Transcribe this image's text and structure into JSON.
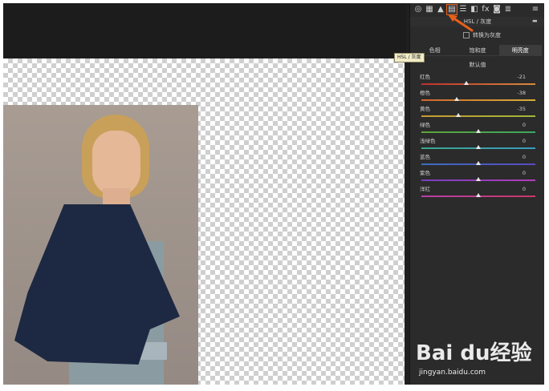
{
  "panel": {
    "section_title": "HSL / 灰度",
    "convert_gray_label": "转换为灰度",
    "tabs": [
      {
        "label": "色相",
        "active": false
      },
      {
        "label": "饱和度",
        "active": false
      },
      {
        "label": "明亮度",
        "active": true
      }
    ],
    "tooltip": "HSL / 灰度",
    "default_link": "默认值",
    "sliders": [
      {
        "label": "红色",
        "value": "-21",
        "position": -21,
        "gradient": [
          "#c0302e",
          "#d88a39"
        ]
      },
      {
        "label": "橙色",
        "value": "-38",
        "position": -38,
        "gradient": [
          "#d2662e",
          "#d8b039"
        ]
      },
      {
        "label": "黄色",
        "value": "-35",
        "position": -35,
        "gradient": [
          "#c99a32",
          "#9fb83a"
        ]
      },
      {
        "label": "绿色",
        "value": "0",
        "position": 0,
        "gradient": [
          "#5ea43a",
          "#3aa860"
        ]
      },
      {
        "label": "浅绿色",
        "value": "0",
        "position": 0,
        "gradient": [
          "#3aa68e",
          "#3a9cc0"
        ]
      },
      {
        "label": "蓝色",
        "value": "0",
        "position": 0,
        "gradient": [
          "#3a6ec0",
          "#5a4ac0"
        ]
      },
      {
        "label": "紫色",
        "value": "0",
        "position": 0,
        "gradient": [
          "#7a3ec0",
          "#b03eb8"
        ]
      },
      {
        "label": "洋红",
        "value": "0",
        "position": 0,
        "gradient": [
          "#b83ea8",
          "#c83868"
        ]
      }
    ],
    "accent_color": "#e8601a"
  },
  "toolbar_icons": [
    {
      "name": "aperture-icon",
      "glyph": "◎",
      "active": false
    },
    {
      "name": "histogram-icon",
      "glyph": "▦",
      "active": false
    },
    {
      "name": "tone-curve-icon",
      "glyph": "▲",
      "active": false
    },
    {
      "name": "hsl-icon",
      "glyph": "▤",
      "active": true
    },
    {
      "name": "split-toning-icon",
      "glyph": "☰",
      "active": false
    },
    {
      "name": "detail-icon",
      "glyph": "◧",
      "active": false
    },
    {
      "name": "fx-icon",
      "glyph": "fx",
      "active": false
    },
    {
      "name": "camera-icon",
      "glyph": "◙",
      "active": false
    },
    {
      "name": "presets-icon",
      "glyph": "≣",
      "active": false
    }
  ],
  "watermark": {
    "logo": "Bai du经验",
    "url": "jingyan.baidu.com"
  }
}
